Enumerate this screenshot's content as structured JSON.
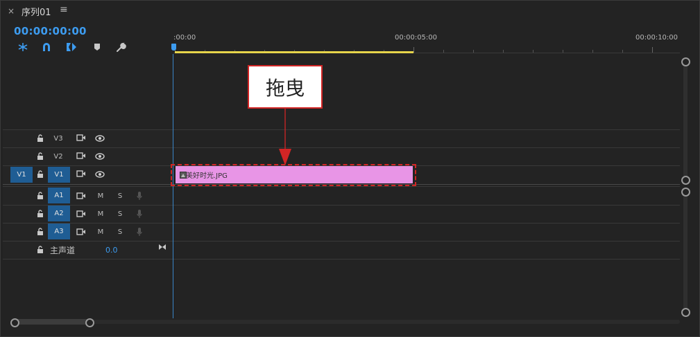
{
  "panel": {
    "close_glyph": "×",
    "title": "序列01",
    "menu_glyph": "≡",
    "timecode": "00:00:00:00"
  },
  "toolbar_icons": [
    "snap-nest-icon",
    "magnet-snap-icon",
    "linked-selection-icon",
    "add-marker-icon",
    "wrench-settings-icon"
  ],
  "ruler": {
    "labels": [
      ":00:00",
      "00:00:05:00",
      "00:00:10:00"
    ]
  },
  "tracks": {
    "video": [
      {
        "id": "V3",
        "source": "",
        "targeted": false
      },
      {
        "id": "V2",
        "source": "",
        "targeted": false
      },
      {
        "id": "V1",
        "source": "V1",
        "targeted": true
      }
    ],
    "audio": [
      {
        "id": "A1",
        "mute": "M",
        "solo": "S"
      },
      {
        "id": "A2",
        "mute": "M",
        "solo": "S"
      },
      {
        "id": "A3",
        "mute": "M",
        "solo": "S"
      }
    ],
    "master": {
      "label": "主声道",
      "value": "0.0"
    }
  },
  "clip": {
    "name": "美好时光.JPG",
    "color": "#e895e6"
  },
  "annotation": {
    "label": "拖曳",
    "color": "#d22525"
  },
  "colors": {
    "accent": "#3d9cf0",
    "track_target": "#1f5d94",
    "workarea": "#e6d44a"
  }
}
